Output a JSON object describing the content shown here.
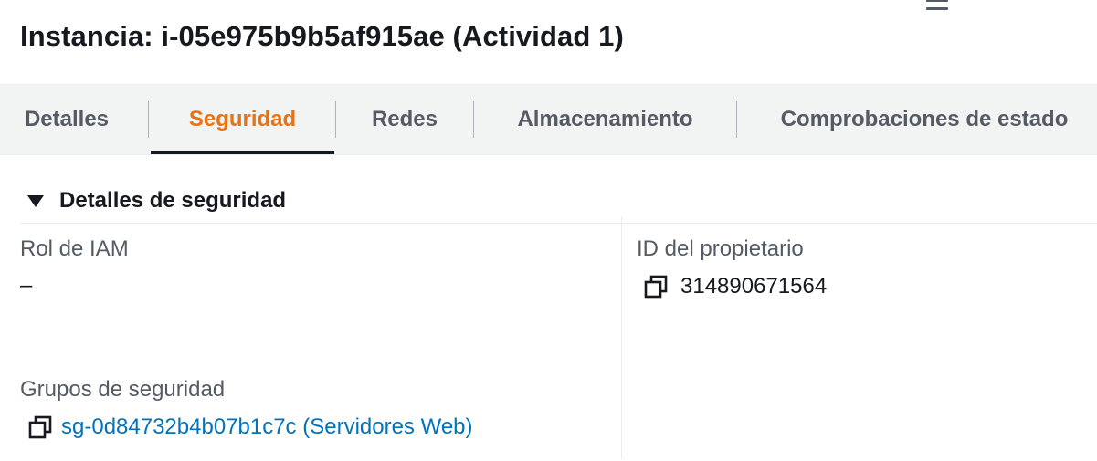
{
  "page": {
    "title": "Instancia: i-05e975b9b5af915ae (Actividad 1)"
  },
  "tabs": [
    {
      "label": "Detalles",
      "active": false
    },
    {
      "label": "Seguridad",
      "active": true
    },
    {
      "label": "Redes",
      "active": false
    },
    {
      "label": "Almacenamiento",
      "active": false
    },
    {
      "label": "Comprobaciones de estado",
      "active": false
    }
  ],
  "security_details": {
    "section_title": "Detalles de seguridad",
    "iam_role": {
      "label": "Rol de IAM",
      "value": "–"
    },
    "owner_id": {
      "label": "ID del propietario",
      "value": "314890671564"
    },
    "security_groups": {
      "label": "Grupos de seguridad",
      "value": "sg-0d84732b4b07b1c7c (Servidores Web)"
    }
  },
  "icons": {
    "menu": "hamburger-menu-icon",
    "caret": "caret-down-icon",
    "copy": "copy-icon"
  },
  "colors": {
    "active_tab": "#ec7211",
    "link": "#0073bb",
    "tab_bar_bg": "#f2f3f3"
  }
}
